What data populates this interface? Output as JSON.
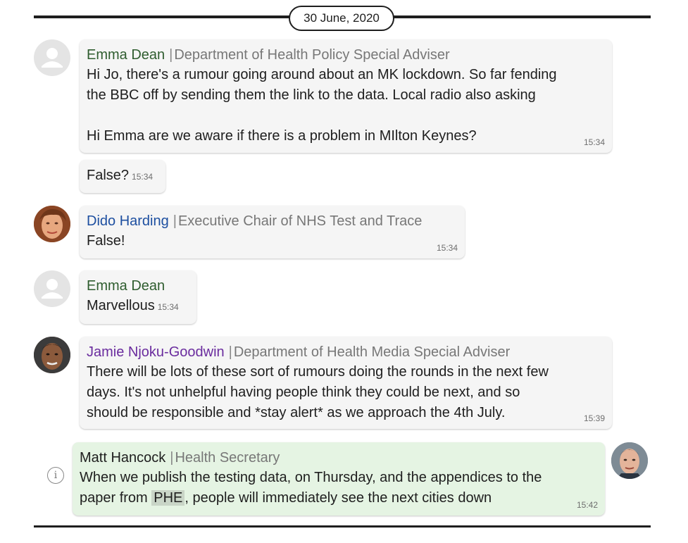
{
  "date_label": "30 June, 2020",
  "colors": {
    "emma": "#2f5d2f",
    "dido": "#1d4fa0",
    "jamie": "#6a2c9e",
    "matt": "#1e1e1e"
  },
  "messages": [
    {
      "sender": "Emma Dean",
      "role": "Department of Health Policy Special Adviser",
      "text": "Hi Jo, there's a rumour going around about an MK lockdown. So far fending\nthe BBC off by sending them the link to the data. Local radio also asking\n\nHi Emma are we aware if there is a problem in MIlton Keynes?",
      "time": "15:34"
    },
    {
      "text": "False?",
      "time": "15:34"
    },
    {
      "sender": "Dido Harding",
      "role": "Executive Chair of NHS Test and Trace",
      "text": "False!",
      "time": "15:34"
    },
    {
      "sender": "Emma Dean",
      "text": "Marvellous",
      "time": "15:34"
    },
    {
      "sender": "Jamie Njoku-Goodwin",
      "role": "Department of Health Media Special Adviser",
      "text": "There will be lots of these sort of rumours doing the rounds in the next few\ndays. It's not unhelpful having people think they could be next, and so\nshould be responsible and *stay alert* as we approach the 4th July.",
      "time": "15:39"
    },
    {
      "sender": "Matt Hancock",
      "role": "Health Secretary",
      "text_before": "When we publish the testing data, on Thursday, and the appendices to the\npaper from ",
      "highlight": "PHE",
      "text_after": ", people will immediately see the next cities down",
      "time": "15:42"
    }
  ],
  "icons": {
    "info": "info-icon",
    "generic_avatar": "person-silhouette-icon"
  }
}
